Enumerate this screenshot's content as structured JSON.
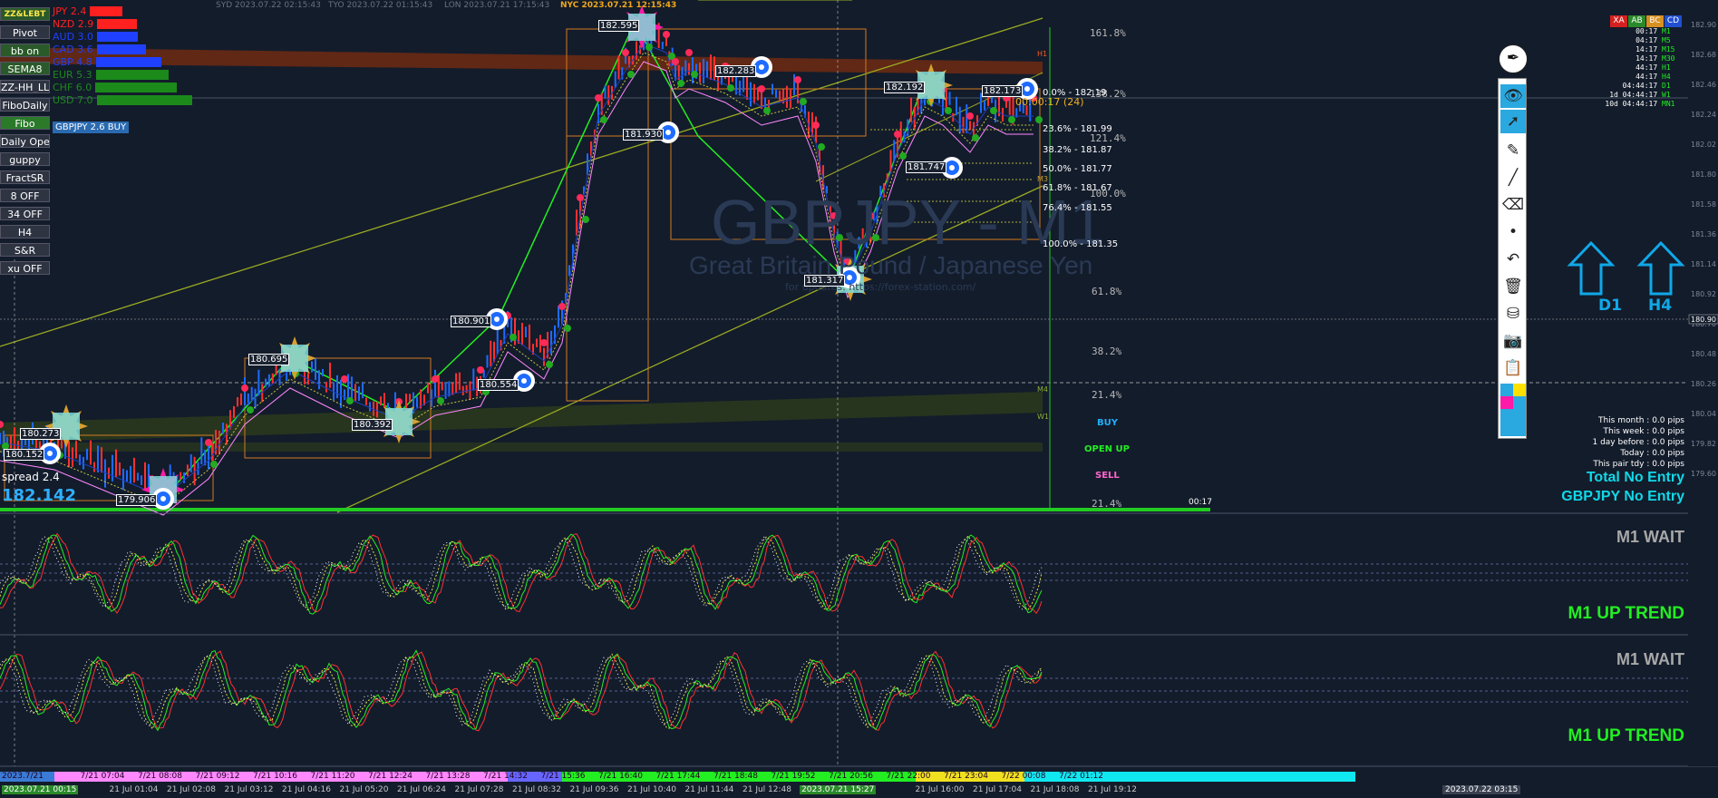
{
  "symbol_title": "GBPJPY - M1",
  "symbol_subtitle": "Great Britain Pound / Japanese Yen",
  "watermark_url": "for updates: https://forex-station.com/",
  "left_buttons": [
    "ZZ&LEBT",
    "Pivot",
    "bb on",
    "SEMA8",
    "ZZ-HH_LL",
    "FiboDaily",
    "Fibo",
    "Daily Open",
    "guppy",
    "FractSR",
    "8 OFF",
    "34 OFF",
    "H4",
    "S&R",
    "xu OFF"
  ],
  "currencies": [
    {
      "name": "JPY",
      "value": "2.4",
      "color": "#ff2020"
    },
    {
      "name": "NZD",
      "value": "2.9",
      "color": "#ff2020"
    },
    {
      "name": "AUD",
      "value": "3.0",
      "color": "#2040ff"
    },
    {
      "name": "CAD",
      "value": "3.6",
      "color": "#2040ff"
    },
    {
      "name": "GBP",
      "value": "4.8",
      "color": "#2040ff"
    },
    {
      "name": "EUR",
      "value": "5.3",
      "color": "#1b8a1b"
    },
    {
      "name": "CHF",
      "value": "6.0",
      "color": "#1b8a1b"
    },
    {
      "name": "USD",
      "value": "7.0",
      "color": "#1b8a1b"
    }
  ],
  "pair_signal": "GBPJPY 2.6 BUY",
  "sessions": [
    "SYD 2023.07.22 02:15:43",
    "TYO 2023.07.22 01:15:43",
    "LON 2023.07.21 17:15:43",
    "NYC 2023.07.21 12:15:43"
  ],
  "spread": "spread 2.4",
  "bid_price": "182.142",
  "fib_percent_labels": [
    "161.8%",
    "138.2%",
    "121.4%",
    "100.0%",
    "61.8%",
    "38.2%",
    "21.4%",
    "21.4%"
  ],
  "fib_levels": [
    "0.0% - 182.19",
    "23.6% - 181.99",
    "38.2% - 181.87",
    "50.0% - 181.77",
    "61.8% - 181.67",
    "76.4% - 181.55",
    "100.0% - 181.35"
  ],
  "countdown": "00:00:17 (24)",
  "countdown_short": "00:17",
  "price_labels": [
    "182.595",
    "182.283",
    "182.192",
    "182.173",
    "181.930",
    "181.747",
    "181.317",
    "180.901",
    "180.554",
    "180.695",
    "180.392",
    "180.273",
    "180.152",
    "179.906"
  ],
  "trade_labels": {
    "buy": "BUY",
    "open": "OPEN UP",
    "sell": "SELL"
  },
  "timeframes": [
    {
      "time": "00:17",
      "tf": "M1"
    },
    {
      "time": "04:17",
      "tf": "M5"
    },
    {
      "time": "14:17",
      "tf": "M15"
    },
    {
      "time": "14:17",
      "tf": "M30"
    },
    {
      "time": "44:17",
      "tf": "H1"
    },
    {
      "time": "44:17",
      "tf": "H4"
    },
    {
      "time": "04:44:17",
      "tf": "D1"
    },
    {
      "time": "1d 04:44:17",
      "tf": "W1"
    },
    {
      "time": "10d 04:44:17",
      "tf": "MN1"
    }
  ],
  "mini_buttons": [
    "XA",
    "AB",
    "BC",
    "CD"
  ],
  "arrow_labels": [
    "D1",
    "H4"
  ],
  "stats": [
    "This month : 0.0 pips",
    "This week : 0.0 pips",
    "1 day before : 0.0 pips",
    "Today : 0.0 pips",
    "This pair tdy : 0.0 pips"
  ],
  "entry_total": "Total No Entry",
  "entry_pair": "GBPJPY No Entry",
  "osc1_status": "M1 WAIT",
  "osc1_trend": "M1 UP TREND",
  "osc2_status": "M1 WAIT",
  "osc2_trend": "M1 UP TREND",
  "time_labels": [
    "2023.7/21",
    "7/21 07:04",
    "7/21 08:08",
    "7/21 09:12",
    "7/21 10:16",
    "7/21 11:20",
    "7/21 12:24",
    "7/21 13:28",
    "7/21 14:32",
    "7/21 15:36",
    "7/21 16:40",
    "7/21 17:44",
    "7/21 18:48",
    "7/21 19:52",
    "7/21 20:56",
    "7/21 22:00",
    "7/21 23:04",
    "7/22 00:08",
    "7/22 01:12"
  ],
  "date_labels": [
    "2023.07.21 00:15",
    "21 Jul 01:04",
    "21 Jul 02:08",
    "21 Jul 03:12",
    "21 Jul 04:16",
    "21 Jul 05:20",
    "21 Jul 06:24",
    "21 Jul 07:28",
    "21 Jul 08:32",
    "21 Jul 09:36",
    "21 Jul 10:40",
    "21 Jul 11:44",
    "21 Jul 12:48",
    "21 Jul 13:52",
    "2023.07.21 15:27",
    "21 Jul 16:00",
    "21 Jul 17:04",
    "21 Jul 18:08",
    "21 Jul 19:12"
  ],
  "date_right": "2023.07.22 03:15",
  "colors": {
    "bg": "#131c2b",
    "green": "#22ee22",
    "cyan": "#10c8ff",
    "candle_up": "#1e6bff",
    "candle_dn": "#ff3030"
  }
}
